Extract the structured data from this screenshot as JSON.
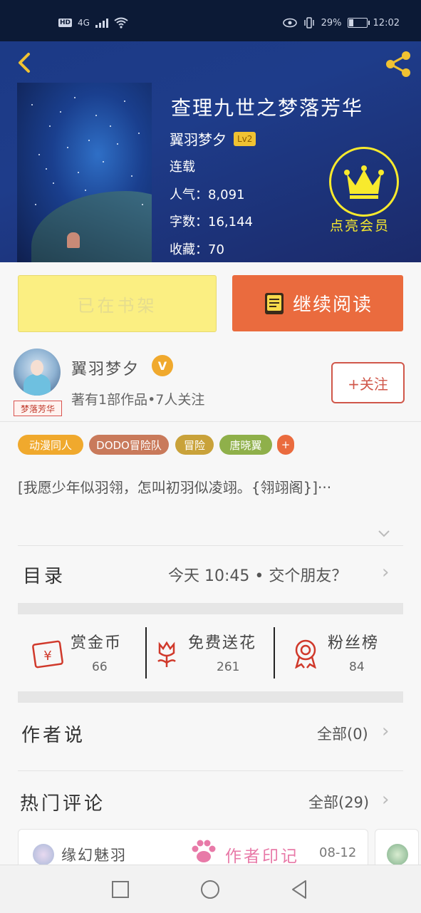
{
  "status_bar": {
    "hd": "HD",
    "network": "4G",
    "battery": "29%",
    "battery_level": 0.29,
    "time": "12:02"
  },
  "book": {
    "title": "查理九世之梦落芳华",
    "author": "翼羽梦夕",
    "author_level": "Lv2",
    "status": "连载",
    "popularity_label": "人气：",
    "popularity": "8,091",
    "word_count_label": "字数：",
    "word_count": "16,144",
    "favorites_label": "收藏：",
    "favorites": "70",
    "vip_label": "点亮会员"
  },
  "actions": {
    "on_shelf": "已在书架",
    "continue_reading": "继续阅读"
  },
  "author": {
    "name": "翼羽梦夕",
    "verified_badge": "V",
    "stats": "著有1部作品•7人关注",
    "follow": "+关注",
    "stamp": "梦落芳华"
  },
  "tags": [
    {
      "label": "动漫同人",
      "color": "#f0a92d"
    },
    {
      "label": "DODO冒险队",
      "color": "#c97a5b"
    },
    {
      "label": "冒险",
      "color": "#c9a23a"
    },
    {
      "label": "唐晓翼",
      "color": "#8fb04a"
    },
    {
      "label": "+",
      "color": "#ea6b3e"
    }
  ],
  "summary": "[我愿少年似羽翎，怎叫初羽似凌翊。{翎翊阁}]···",
  "toc": {
    "label": "目录",
    "latest": "今天 10:45 • 交个朋友？"
  },
  "gifts": [
    {
      "label": "赏金币",
      "value": "66",
      "icon": "red-envelope-icon",
      "color": "#d0392b"
    },
    {
      "label": "免费送花",
      "value": "261",
      "icon": "flower-icon",
      "color": "#d0392b"
    },
    {
      "label": "粉丝榜",
      "value": "84",
      "icon": "medal-icon",
      "color": "#d0392b"
    }
  ],
  "author_says": {
    "title": "作者说",
    "all": "全部(0)"
  },
  "hot_comments": {
    "title": "热门评论",
    "all": "全部(29)",
    "first": {
      "user": "缘幻魅羽",
      "badge": "作者印记",
      "date": "08-12"
    }
  }
}
